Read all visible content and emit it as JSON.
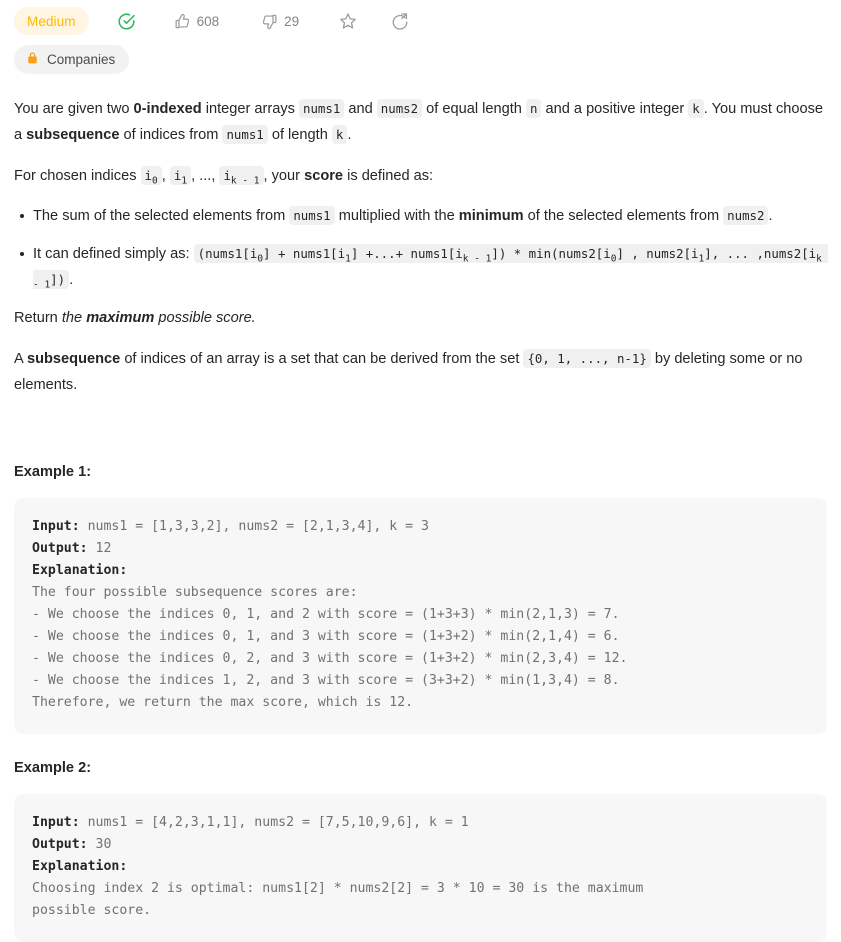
{
  "header": {
    "difficulty": "Medium",
    "solved_icon": "check-circle-icon",
    "likes_icon": "thumbs-up-icon",
    "likes_count": "608",
    "dislikes_icon": "thumbs-down-icon",
    "dislikes_count": "29",
    "favorite_icon": "star-icon",
    "share_icon": "share-icon",
    "companies_icon": "lock-icon",
    "companies_label": "Companies",
    "accent_difficulty_color": "#ffb800",
    "accent_difficulty_bg": "#fff5e3",
    "accent_solved_color": "#2db55d",
    "accent_lock_color": "#f89f1b"
  },
  "description": {
    "p1": {
      "t1": "You are given two ",
      "b1": "0-indexed",
      "t2": " integer arrays ",
      "c1": "nums1",
      "t3": " and ",
      "c2": "nums2",
      "t4": " of equal length ",
      "c3": "n",
      "t5": " and a positive integer ",
      "c4": "k",
      "t6": ". You must choose a ",
      "b2": "subsequence",
      "t7": " of indices from ",
      "c5": "nums1",
      "t8": " of length ",
      "c6": "k",
      "t9": "."
    },
    "p2": {
      "t1": "For chosen indices ",
      "c1": "i",
      "c1sub": "0",
      "t2": ", ",
      "c2": "i",
      "c2sub": "1",
      "t3": ", ..., ",
      "c3": "i",
      "c3sub": "k - 1",
      "t4": ", your ",
      "b1": "score",
      "t5": " is defined as:"
    },
    "bullet1": {
      "t1": "The sum of the selected elements from ",
      "c1": "nums1",
      "t2": " multiplied with the ",
      "b1": "minimum",
      "t3": " of the selected elements from ",
      "c2": "nums2",
      "t4": "."
    },
    "bullet2": {
      "t1": "It can defined simply as: ",
      "code_part1": "(nums1[i",
      "sub1": "0",
      "code_part2": "] + nums1[i",
      "sub2": "1",
      "code_part3": "] +...+ nums1[i",
      "sub3": "k - 1",
      "code_part4": "]) * min(nums2[i",
      "sub4": "0",
      "code_part5": "] , nums2[i",
      "sub5": "1",
      "code_part6": "], ... ,nums2[i",
      "sub6": "k - 1",
      "code_part7": "])",
      "t2": "."
    },
    "p3": {
      "t1": "Return ",
      "i1": "the ",
      "ib1": "maximum",
      "i2": " possible score."
    },
    "p4": {
      "t1": "A ",
      "b1": "subsequence",
      "t2": " of indices of an array is a set that can be derived from the set ",
      "c1": "{0, 1, ..., n-1}",
      "t3": " by deleting some or no elements."
    }
  },
  "examples": [
    {
      "title": "Example 1:",
      "input_label": "Input:",
      "input_value": " nums1 = [1,3,3,2], nums2 = [2,1,3,4], k = 3",
      "output_label": "Output:",
      "output_value": " 12",
      "explanation_label": "Explanation:",
      "explanation_body": "\nThe four possible subsequence scores are:\n- We choose the indices 0, 1, and 2 with score = (1+3+3) * min(2,1,3) = 7.\n- We choose the indices 0, 1, and 3 with score = (1+3+2) * min(2,1,4) = 6.\n- We choose the indices 0, 2, and 3 with score = (1+3+2) * min(2,3,4) = 12.\n- We choose the indices 1, 2, and 3 with score = (3+3+2) * min(1,3,4) = 8.\nTherefore, we return the max score, which is 12."
    },
    {
      "title": "Example 2:",
      "input_label": "Input:",
      "input_value": " nums1 = [4,2,3,1,1], nums2 = [7,5,10,9,6], k = 1",
      "output_label": "Output:",
      "output_value": " 30",
      "explanation_label": "Explanation:",
      "explanation_body": "\nChoosing index 2 is optimal: nums1[2] * nums2[2] = 3 * 10 = 30 is the maximum\npossible score."
    }
  ]
}
